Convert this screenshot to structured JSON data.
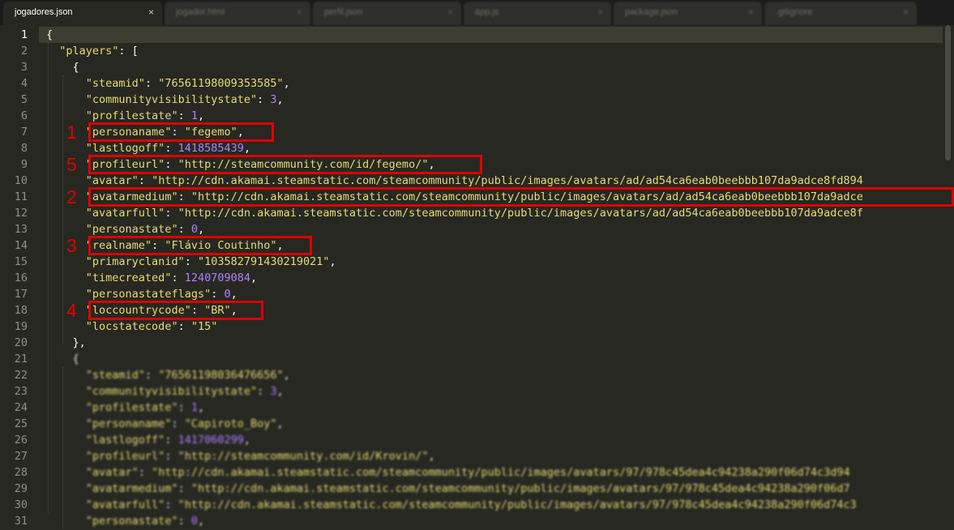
{
  "tabs": [
    {
      "label": "jogadores.json",
      "active": true
    },
    {
      "label": "jogador.html",
      "active": false
    },
    {
      "label": "perfil.json",
      "active": false
    },
    {
      "label": "app.js",
      "active": false
    },
    {
      "label": "package.json",
      "active": false
    },
    {
      "label": ".gitignore",
      "active": false
    }
  ],
  "tab_close_glyph": "×",
  "colors": {
    "editor_bg": "#272822",
    "string": "#e6db74",
    "number": "#ae81ff",
    "plain": "#f8f8f2",
    "annotation": "#e00000"
  },
  "code": {
    "lines": [
      [
        {
          "t": "p",
          "v": "{"
        }
      ],
      [
        {
          "t": "p",
          "v": "  "
        },
        {
          "t": "s",
          "v": "\"players\""
        },
        {
          "t": "p",
          "v": ": ["
        }
      ],
      [
        {
          "t": "p",
          "v": "    {"
        }
      ],
      [
        {
          "t": "p",
          "v": "      "
        },
        {
          "t": "s",
          "v": "\"steamid\""
        },
        {
          "t": "p",
          "v": ": "
        },
        {
          "t": "s",
          "v": "\"76561198009353585\""
        },
        {
          "t": "p",
          "v": ","
        }
      ],
      [
        {
          "t": "p",
          "v": "      "
        },
        {
          "t": "s",
          "v": "\"communityvisibilitystate\""
        },
        {
          "t": "p",
          "v": ": "
        },
        {
          "t": "n",
          "v": "3"
        },
        {
          "t": "p",
          "v": ","
        }
      ],
      [
        {
          "t": "p",
          "v": "      "
        },
        {
          "t": "s",
          "v": "\"profilestate\""
        },
        {
          "t": "p",
          "v": ": "
        },
        {
          "t": "n",
          "v": "1"
        },
        {
          "t": "p",
          "v": ","
        }
      ],
      [
        {
          "t": "p",
          "v": "      "
        },
        {
          "t": "s",
          "v": "\"personaname\""
        },
        {
          "t": "p",
          "v": ": "
        },
        {
          "t": "s",
          "v": "\"fegemo\""
        },
        {
          "t": "p",
          "v": ","
        }
      ],
      [
        {
          "t": "p",
          "v": "      "
        },
        {
          "t": "s",
          "v": "\"lastlogoff\""
        },
        {
          "t": "p",
          "v": ": "
        },
        {
          "t": "n",
          "v": "1418585439"
        },
        {
          "t": "p",
          "v": ","
        }
      ],
      [
        {
          "t": "p",
          "v": "      "
        },
        {
          "t": "s",
          "v": "\"profileurl\""
        },
        {
          "t": "p",
          "v": ": "
        },
        {
          "t": "s",
          "v": "\"http://steamcommunity.com/id/fegemo/\""
        },
        {
          "t": "p",
          "v": ","
        }
      ],
      [
        {
          "t": "p",
          "v": "      "
        },
        {
          "t": "s",
          "v": "\"avatar\""
        },
        {
          "t": "p",
          "v": ": "
        },
        {
          "t": "s",
          "v": "\"http://cdn.akamai.steamstatic.com/steamcommunity/public/images/avatars/ad/ad54ca6eab0beebbb107da9adce8fd894"
        }
      ],
      [
        {
          "t": "p",
          "v": "      "
        },
        {
          "t": "s",
          "v": "\"avatarmedium\""
        },
        {
          "t": "p",
          "v": ": "
        },
        {
          "t": "s",
          "v": "\"http://cdn.akamai.steamstatic.com/steamcommunity/public/images/avatars/ad/ad54ca6eab0beebbb107da9adce"
        }
      ],
      [
        {
          "t": "p",
          "v": "      "
        },
        {
          "t": "s",
          "v": "\"avatarfull\""
        },
        {
          "t": "p",
          "v": ": "
        },
        {
          "t": "s",
          "v": "\"http://cdn.akamai.steamstatic.com/steamcommunity/public/images/avatars/ad/ad54ca6eab0beebbb107da9adce8f"
        }
      ],
      [
        {
          "t": "p",
          "v": "      "
        },
        {
          "t": "s",
          "v": "\"personastate\""
        },
        {
          "t": "p",
          "v": ": "
        },
        {
          "t": "n",
          "v": "0"
        },
        {
          "t": "p",
          "v": ","
        }
      ],
      [
        {
          "t": "p",
          "v": "      "
        },
        {
          "t": "s",
          "v": "\"realname\""
        },
        {
          "t": "p",
          "v": ": "
        },
        {
          "t": "s",
          "v": "\"Flávio Coutinho\""
        },
        {
          "t": "p",
          "v": ","
        }
      ],
      [
        {
          "t": "p",
          "v": "      "
        },
        {
          "t": "s",
          "v": "\"primaryclanid\""
        },
        {
          "t": "p",
          "v": ": "
        },
        {
          "t": "s",
          "v": "\"103582791430219021\""
        },
        {
          "t": "p",
          "v": ","
        }
      ],
      [
        {
          "t": "p",
          "v": "      "
        },
        {
          "t": "s",
          "v": "\"timecreated\""
        },
        {
          "t": "p",
          "v": ": "
        },
        {
          "t": "n",
          "v": "1240709084"
        },
        {
          "t": "p",
          "v": ","
        }
      ],
      [
        {
          "t": "p",
          "v": "      "
        },
        {
          "t": "s",
          "v": "\"personastateflags\""
        },
        {
          "t": "p",
          "v": ": "
        },
        {
          "t": "n",
          "v": "0"
        },
        {
          "t": "p",
          "v": ","
        }
      ],
      [
        {
          "t": "p",
          "v": "      "
        },
        {
          "t": "s",
          "v": "\"loccountrycode\""
        },
        {
          "t": "p",
          "v": ": "
        },
        {
          "t": "s",
          "v": "\"BR\""
        },
        {
          "t": "p",
          "v": ","
        }
      ],
      [
        {
          "t": "p",
          "v": "      "
        },
        {
          "t": "s",
          "v": "\"locstatecode\""
        },
        {
          "t": "p",
          "v": ": "
        },
        {
          "t": "s",
          "v": "\"15\""
        }
      ],
      [
        {
          "t": "p",
          "v": "    },"
        }
      ],
      [
        {
          "t": "p",
          "v": "    {"
        }
      ],
      [
        {
          "t": "p",
          "v": "      "
        },
        {
          "t": "s",
          "v": "\"steamid\""
        },
        {
          "t": "p",
          "v": ": "
        },
        {
          "t": "s",
          "v": "\"76561198036476656\""
        },
        {
          "t": "p",
          "v": ","
        }
      ],
      [
        {
          "t": "p",
          "v": "      "
        },
        {
          "t": "s",
          "v": "\"communityvisibilitystate\""
        },
        {
          "t": "p",
          "v": ": "
        },
        {
          "t": "n",
          "v": "3"
        },
        {
          "t": "p",
          "v": ","
        }
      ],
      [
        {
          "t": "p",
          "v": "      "
        },
        {
          "t": "s",
          "v": "\"profilestate\""
        },
        {
          "t": "p",
          "v": ": "
        },
        {
          "t": "n",
          "v": "1"
        },
        {
          "t": "p",
          "v": ","
        }
      ],
      [
        {
          "t": "p",
          "v": "      "
        },
        {
          "t": "s",
          "v": "\"personaname\""
        },
        {
          "t": "p",
          "v": ": "
        },
        {
          "t": "s",
          "v": "\"Capiroto_Boy\""
        },
        {
          "t": "p",
          "v": ","
        }
      ],
      [
        {
          "t": "p",
          "v": "      "
        },
        {
          "t": "s",
          "v": "\"lastlogoff\""
        },
        {
          "t": "p",
          "v": ": "
        },
        {
          "t": "n",
          "v": "1417060299"
        },
        {
          "t": "p",
          "v": ","
        }
      ],
      [
        {
          "t": "p",
          "v": "      "
        },
        {
          "t": "s",
          "v": "\"profileurl\""
        },
        {
          "t": "p",
          "v": ": "
        },
        {
          "t": "s",
          "v": "\"http://steamcommunity.com/id/Krovin/\""
        },
        {
          "t": "p",
          "v": ","
        }
      ],
      [
        {
          "t": "p",
          "v": "      "
        },
        {
          "t": "s",
          "v": "\"avatar\""
        },
        {
          "t": "p",
          "v": ": "
        },
        {
          "t": "s",
          "v": "\"http://cdn.akamai.steamstatic.com/steamcommunity/public/images/avatars/97/978c45dea4c94238a290f06d74c3d94"
        }
      ],
      [
        {
          "t": "p",
          "v": "      "
        },
        {
          "t": "s",
          "v": "\"avatarmedium\""
        },
        {
          "t": "p",
          "v": ": "
        },
        {
          "t": "s",
          "v": "\"http://cdn.akamai.steamstatic.com/steamcommunity/public/images/avatars/97/978c45dea4c94238a290f06d7"
        }
      ],
      [
        {
          "t": "p",
          "v": "      "
        },
        {
          "t": "s",
          "v": "\"avatarfull\""
        },
        {
          "t": "p",
          "v": ": "
        },
        {
          "t": "s",
          "v": "\"http://cdn.akamai.steamstatic.com/steamcommunity/public/images/avatars/97/978c45dea4c94238a290f06d74c3"
        }
      ],
      [
        {
          "t": "p",
          "v": "      "
        },
        {
          "t": "s",
          "v": "\"personastate\""
        },
        {
          "t": "p",
          "v": ": "
        },
        {
          "t": "n",
          "v": "0"
        },
        {
          "t": "p",
          "v": ","
        }
      ]
    ]
  },
  "annotations": [
    {
      "label": "1",
      "line": 7
    },
    {
      "label": "5",
      "line": 9
    },
    {
      "label": "2",
      "line": 11
    },
    {
      "label": "3",
      "line": 14
    },
    {
      "label": "4",
      "line": 18
    }
  ]
}
